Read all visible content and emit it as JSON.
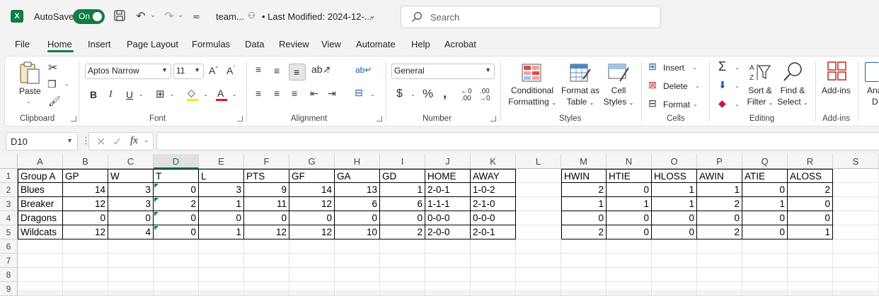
{
  "titlebar": {
    "autosave_label": "AutoSave",
    "autosave_state": "On",
    "doc_title": "team...",
    "doc_meta": "• Last Modified: 2024-12-...",
    "search_placeholder": "Search"
  },
  "menu_tabs": [
    "File",
    "Home",
    "Insert",
    "Page Layout",
    "Formulas",
    "Data",
    "Review",
    "View",
    "Automate",
    "Help",
    "Acrobat"
  ],
  "ribbon": {
    "clipboard": {
      "label": "Clipboard",
      "paste": "Paste"
    },
    "font": {
      "label": "Font",
      "name": "Aptos Narrow",
      "size": "11"
    },
    "alignment": {
      "label": "Alignment"
    },
    "number": {
      "label": "Number",
      "format": "General"
    },
    "styles": {
      "label": "Styles",
      "conditional_1": "Conditional",
      "conditional_2": "Formatting",
      "format_table_1": "Format as",
      "format_table_2": "Table",
      "cell_styles_1": "Cell",
      "cell_styles_2": "Styles"
    },
    "cells": {
      "label": "Cells",
      "insert": "Insert",
      "delete": "Delete",
      "format": "Format"
    },
    "editing": {
      "label": "Editing",
      "sort_1": "Sort &",
      "sort_2": "Filter",
      "find_1": "Find &",
      "find_2": "Select"
    },
    "addins": {
      "label": "Add-ins",
      "btn": "Add-ins",
      "partial_1": "Ana",
      "partial_2": "D"
    }
  },
  "formula_bar": {
    "name_box": "D10",
    "fx": "fx",
    "formula": ""
  },
  "grid": {
    "columns": [
      "A",
      "B",
      "C",
      "D",
      "E",
      "F",
      "G",
      "H",
      "I",
      "J",
      "K",
      "L",
      "M",
      "N",
      "O",
      "P",
      "Q",
      "R",
      "S"
    ],
    "rows": [
      "1",
      "2",
      "3",
      "4",
      "5",
      "6",
      "7",
      "8",
      "9"
    ],
    "selected_column": "D",
    "header_row": [
      "Group A",
      "GP",
      "W",
      "T",
      "L",
      "PTS",
      "GF",
      "GA",
      "GD",
      "HOME",
      "AWAY"
    ],
    "data_rows": [
      [
        "Blues",
        "14",
        "3",
        "0",
        "3",
        "9",
        "14",
        "13",
        "1",
        "2-0-1",
        "1-0-2"
      ],
      [
        "Breaker",
        "12",
        "3",
        "2",
        "1",
        "11",
        "12",
        "6",
        "6",
        "1-1-1",
        "2-1-0"
      ],
      [
        "Dragons",
        "0",
        "0",
        "0",
        "0",
        "0",
        "0",
        "0",
        "0",
        "0-0-0",
        "0-0-0"
      ],
      [
        "Wildcats",
        "12",
        "4",
        "0",
        "1",
        "12",
        "12",
        "10",
        "2",
        "2-0-0",
        "2-0-1"
      ]
    ],
    "right_header": [
      "HWIN",
      "HTIE",
      "HLOSS",
      "AWIN",
      "ATIE",
      "ALOSS"
    ],
    "right_rows": [
      [
        "2",
        "0",
        "1",
        "1",
        "0",
        "2"
      ],
      [
        "1",
        "1",
        "1",
        "2",
        "1",
        "0"
      ],
      [
        "0",
        "0",
        "0",
        "0",
        "0",
        "0"
      ],
      [
        "2",
        "0",
        "0",
        "2",
        "0",
        "1"
      ]
    ]
  }
}
